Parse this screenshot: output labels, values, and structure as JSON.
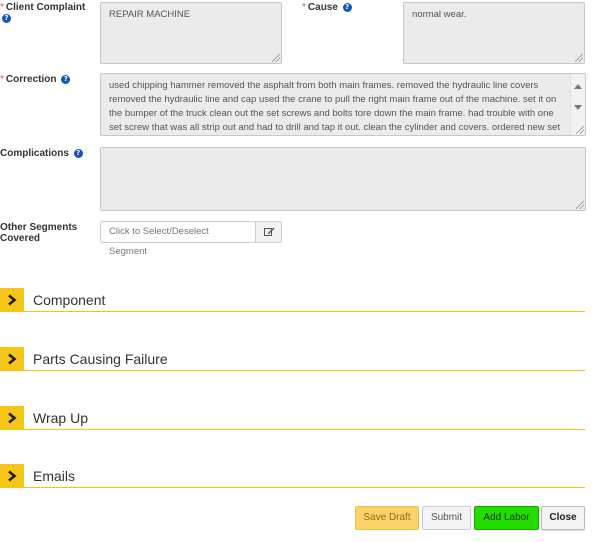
{
  "fields": {
    "client_complaint": {
      "label": "Client Complaint",
      "value": "REPAIR MACHINE"
    },
    "cause": {
      "label": "Cause",
      "value": "normal wear."
    },
    "correction": {
      "label": "Correction",
      "value": "used chipping hammer removed the asphalt from both main frames. removed the hydraulic line covers removed the hydraulic line and cap used the crane to pull the right main frame out of the machine. set it on the bumper of the truck clean out the set screws and bolts tore down the main frame. had trouble with one set screw that was all strip out and had to drill and tap it out. clean the cylinder and covers. ordered new set screws put the cylinder into the new main frame with new bushings. installed new link bolts and the"
    },
    "complications": {
      "label": "Complications",
      "value": ""
    },
    "other_segments": {
      "label_line1": "Other Segments",
      "label_line2": "Covered",
      "placeholder": "Click to Select/Deselect Segment"
    }
  },
  "required_marker": "*",
  "help_glyph": "?",
  "sections": [
    {
      "title": "Component"
    },
    {
      "title": "Parts Causing Failure"
    },
    {
      "title": "Wrap Up"
    },
    {
      "title": "Emails"
    }
  ],
  "buttons": {
    "save_draft": "Save Draft",
    "submit": "Submit",
    "add_labor": "Add Labor",
    "close": "Close"
  },
  "colors": {
    "accent_yellow": "#f5c518",
    "add_labor_green": "#22dd00",
    "save_draft_bg": "#fcd36a",
    "help_blue": "#1455b8",
    "required_red": "#d9534f"
  },
  "icons": {
    "help": "question-circle-icon",
    "section_toggle": "chevron-right-icon",
    "segment_edit": "edit-icon"
  }
}
